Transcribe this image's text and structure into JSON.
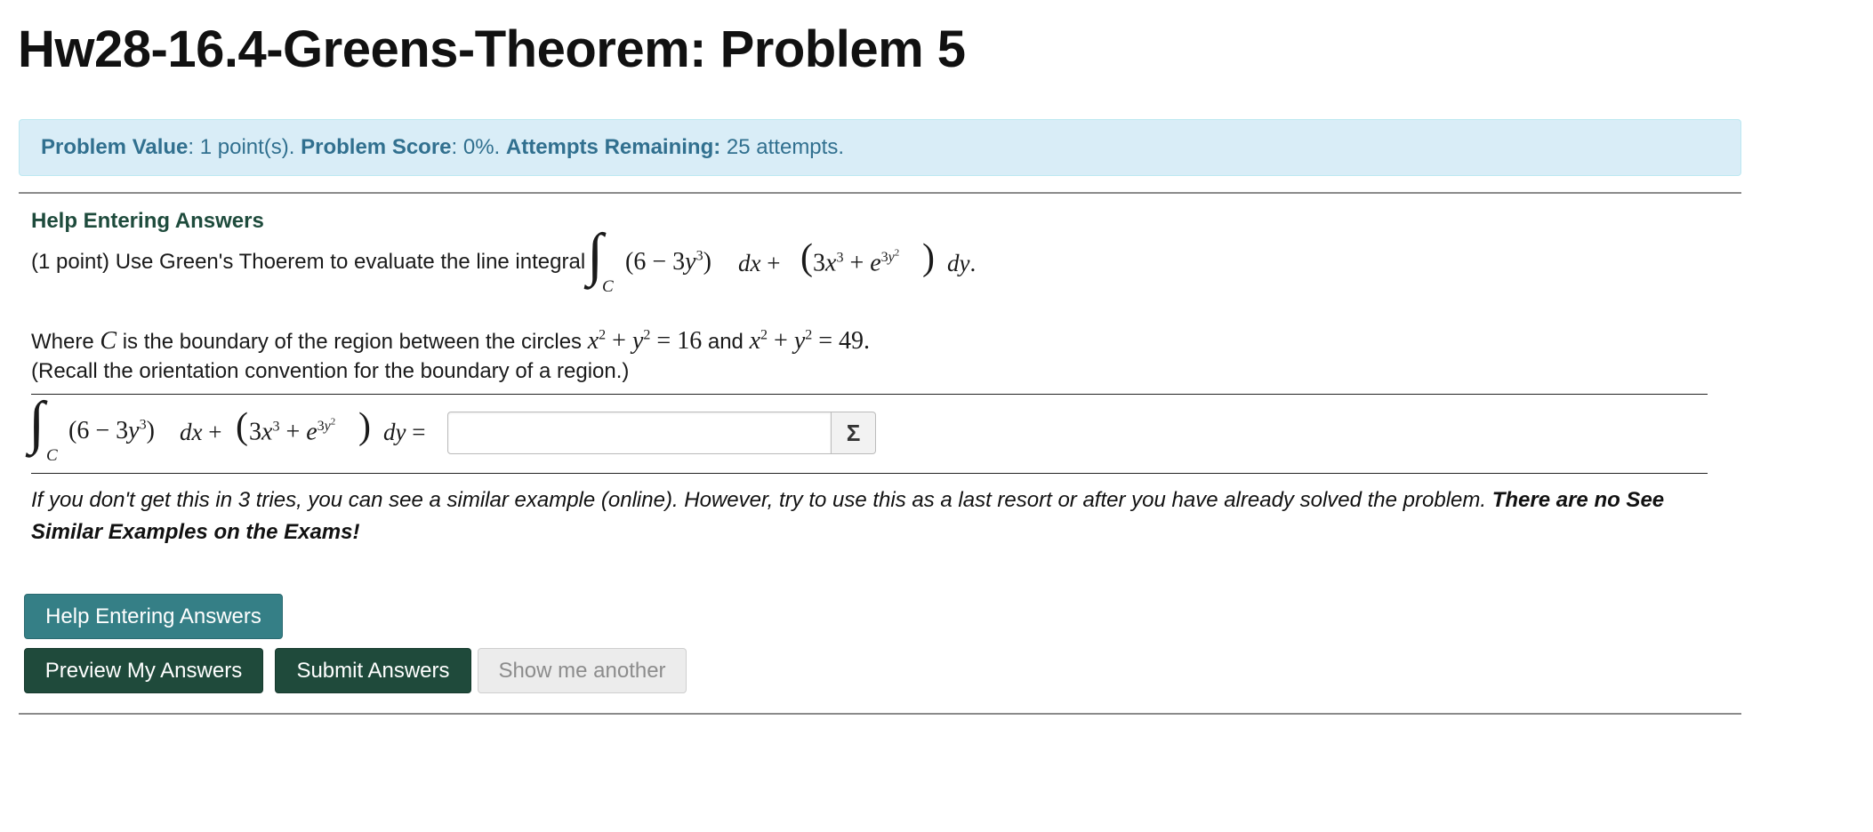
{
  "title": "Hw28-16.4-Greens-Theorem: Problem 5",
  "info": {
    "value_label": "Problem Value",
    "value_text": ": 1 point(s). ",
    "score_label": "Problem Score",
    "score_text": ": 0%. ",
    "attempts_label": "Attempts Remaining:",
    "attempts_text": " 25 attempts."
  },
  "help_heading": "Help Entering Answers",
  "problem": {
    "intro": "(1 point) Use Green's Thoerem to evaluate the line integral",
    "where_prefix": "Where",
    "where_var": "C",
    "where_mid": "is the boundary of the region between the circles",
    "circle1_rhs": "16",
    "and_word": "and",
    "circle2_rhs": "49",
    "recall": "(Recall the orientation convention for the boundary of a region.)",
    "integral_sub": "C"
  },
  "answer": {
    "value": "",
    "sigma_label": "Σ"
  },
  "note": {
    "italic": "If you don't get this in 3 tries, you can see a similar example (online). However, try to use this as a last resort or after you have already solved the problem.",
    "bold": "There are no See Similar Examples on the Exams!"
  },
  "buttons": {
    "help": "Help Entering Answers",
    "preview": "Preview My Answers",
    "submit": "Submit Answers",
    "another": "Show me another"
  }
}
